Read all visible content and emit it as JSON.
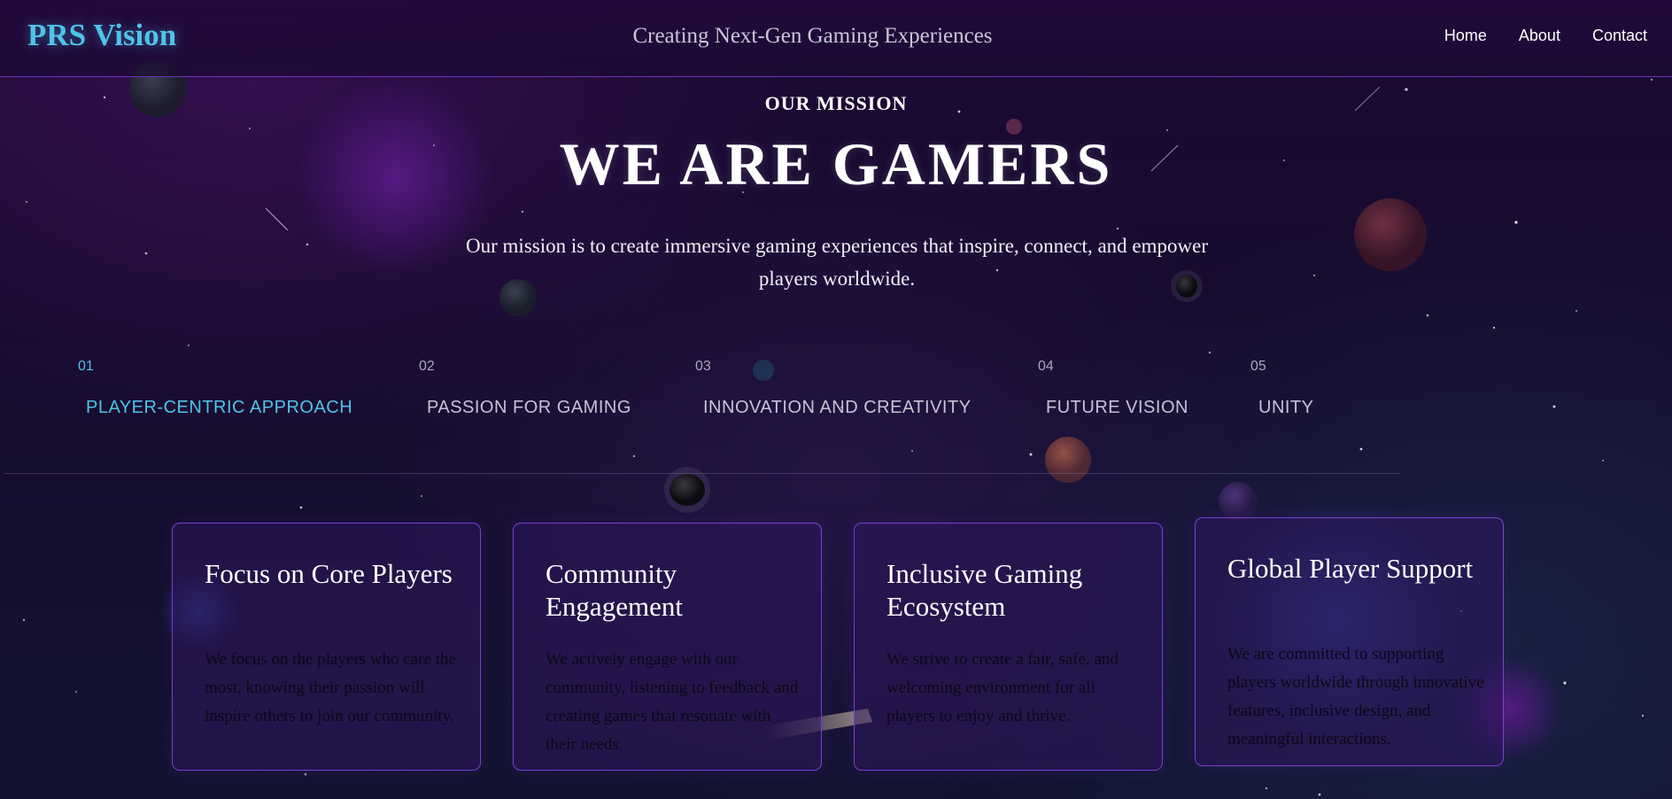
{
  "header": {
    "logo": "PRS Vision",
    "tagline": "Creating Next-Gen Gaming Experiences",
    "nav": [
      "Home",
      "About",
      "Contact"
    ]
  },
  "mission": {
    "eyebrow": "OUR MISSION",
    "title": "WE ARE GAMERS",
    "text": "Our mission is to create immersive gaming experiences that inspire, connect, and empower players worldwide."
  },
  "tabs": [
    {
      "num": "01",
      "label": "PLAYER-CENTRIC APPROACH",
      "active": true
    },
    {
      "num": "02",
      "label": "PASSION FOR GAMING",
      "active": false
    },
    {
      "num": "03",
      "label": "INNOVATION AND CREATIVITY",
      "active": false
    },
    {
      "num": "04",
      "label": "FUTURE VISION",
      "active": false
    },
    {
      "num": "05",
      "label": "UNITY",
      "active": false
    }
  ],
  "cards": [
    {
      "title": "Focus on Core Players",
      "body": "We focus on the players who care the most, knowing their passion will inspire others to join our community."
    },
    {
      "title": "Community Engagement",
      "body": "We actively engage with our community, listening to feedback and creating games that resonate with their needs."
    },
    {
      "title": "Inclusive Gaming Ecosystem",
      "body": "We strive to create a fair, safe, and welcoming environment for all players to enjoy and thrive."
    },
    {
      "title": "Global Player Support",
      "body": "We are committed to supporting players worldwide through innovative features, inclusive design, and meaningful interactions."
    }
  ],
  "colors": {
    "accent": "#4fc3e8",
    "card_border": "#7b3fd0",
    "header_border": "#6d2fb8"
  }
}
